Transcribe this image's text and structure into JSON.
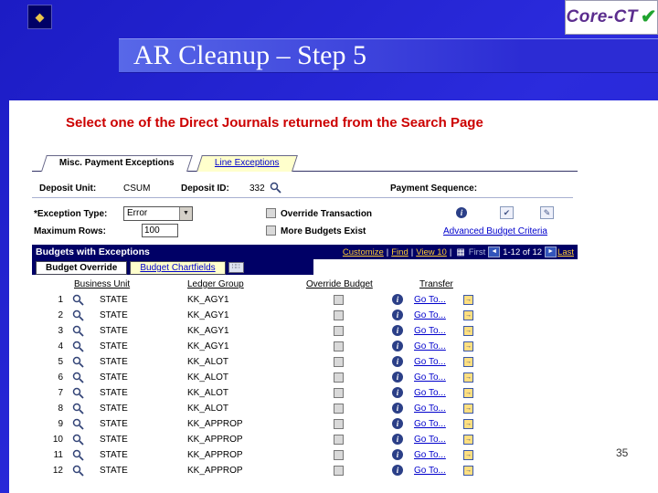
{
  "slide": {
    "title": "AR Cleanup – Step 5",
    "subtitle": "Select one of the Direct Journals returned from the Search Page",
    "page_number": "35",
    "logo": {
      "text": "Core-CT"
    }
  },
  "icons": {
    "dropdown_arrow": "▼",
    "prev_arrow": "◄",
    "next_arrow": "►",
    "info": "i",
    "grid": "▦",
    "pencil": "✎",
    "stamp": "✔",
    "corner": "◆",
    "logo_check": "✔",
    "goto_arrow": "→",
    "columns_button": "∷∷"
  },
  "screenshot": {
    "page_tabs": [
      {
        "label": "Misc. Payment Exceptions"
      },
      {
        "label": "Line Exceptions"
      }
    ],
    "fields": {
      "deposit_unit_label": "Deposit Unit:",
      "deposit_unit_value": "CSUM",
      "deposit_id_label": "Deposit ID:",
      "deposit_id_value": "332",
      "payment_sequence_label": "Payment Sequence:",
      "exception_type_label": "*Exception Type:",
      "exception_type_value": "Error",
      "override_transaction_label": "Override Transaction",
      "maximum_rows_label": "Maximum Rows:",
      "maximum_rows_value": "100",
      "more_budgets_exist_label": "More Budgets Exist",
      "advanced_budget_criteria_link": "Advanced Budget Criteria"
    },
    "grid": {
      "title": "Budgets with Exceptions",
      "toolbar": {
        "customize": "Customize",
        "find": "Find",
        "view": "View 10",
        "first": "First",
        "range": "1-12 of 12",
        "last": "Last"
      },
      "tabs": [
        {
          "label": "Budget Override"
        },
        {
          "label": "Budget Chartfields"
        }
      ],
      "columns": [
        "Business Unit",
        "Ledger Group",
        "Override Budget",
        "Transfer"
      ],
      "rows": [
        {
          "num": "1",
          "business_unit": "STATE",
          "ledger_group": "KK_AGY1",
          "transfer": "Go To..."
        },
        {
          "num": "2",
          "business_unit": "STATE",
          "ledger_group": "KK_AGY1",
          "transfer": "Go To..."
        },
        {
          "num": "3",
          "business_unit": "STATE",
          "ledger_group": "KK_AGY1",
          "transfer": "Go To..."
        },
        {
          "num": "4",
          "business_unit": "STATE",
          "ledger_group": "KK_AGY1",
          "transfer": "Go To..."
        },
        {
          "num": "5",
          "business_unit": "STATE",
          "ledger_group": "KK_ALOT",
          "transfer": "Go To..."
        },
        {
          "num": "6",
          "business_unit": "STATE",
          "ledger_group": "KK_ALOT",
          "transfer": "Go To..."
        },
        {
          "num": "7",
          "business_unit": "STATE",
          "ledger_group": "KK_ALOT",
          "transfer": "Go To..."
        },
        {
          "num": "8",
          "business_unit": "STATE",
          "ledger_group": "KK_ALOT",
          "transfer": "Go To..."
        },
        {
          "num": "9",
          "business_unit": "STATE",
          "ledger_group": "KK_APPROP",
          "transfer": "Go To..."
        },
        {
          "num": "10",
          "business_unit": "STATE",
          "ledger_group": "KK_APPROP",
          "transfer": "Go To..."
        },
        {
          "num": "11",
          "business_unit": "STATE",
          "ledger_group": "KK_APPROP",
          "transfer": "Go To..."
        },
        {
          "num": "12",
          "business_unit": "STATE",
          "ledger_group": "KK_APPROP",
          "transfer": "Go To..."
        }
      ]
    }
  }
}
